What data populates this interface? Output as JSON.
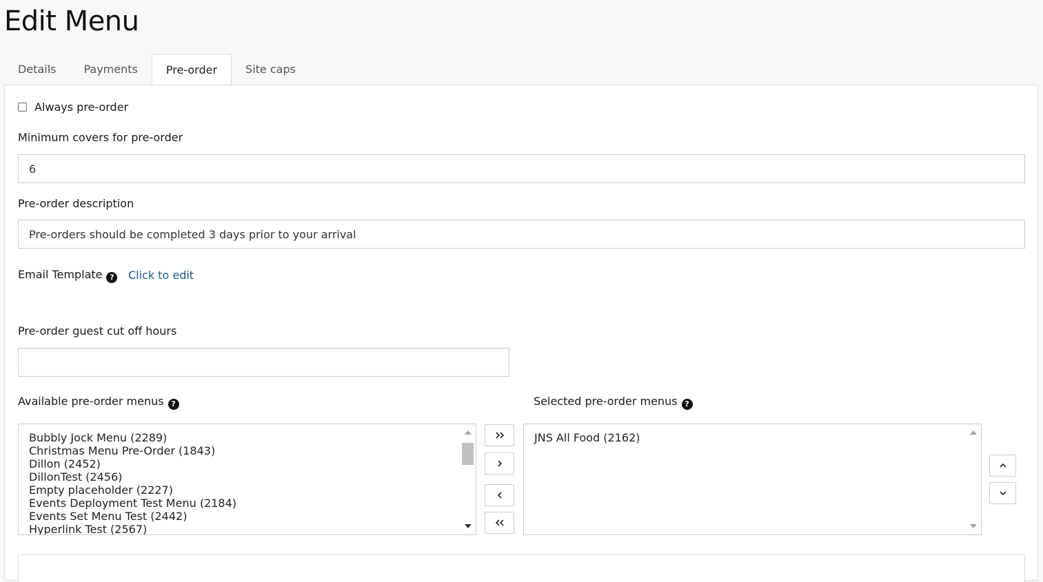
{
  "page": {
    "title": "Edit Menu"
  },
  "tabs": [
    {
      "label": "Details"
    },
    {
      "label": "Payments"
    },
    {
      "label": "Pre-order",
      "active": true
    },
    {
      "label": "Site caps"
    }
  ],
  "form": {
    "always_preorder": {
      "label": "Always pre-order",
      "checked": false
    },
    "min_covers": {
      "label": "Minimum covers for pre-order",
      "value": "6"
    },
    "description": {
      "label": "Pre-order description",
      "value": "Pre-orders should be completed 3 days prior to your arrival"
    },
    "email_template": {
      "label": "Email Template",
      "link": "Click to edit"
    },
    "cut_off_hours": {
      "label": "Pre-order guest cut off hours",
      "value": ""
    }
  },
  "menus": {
    "available_label": "Available pre-order menus",
    "selected_label": "Selected pre-order menus",
    "available": [
      "Bubbly Jock Menu (2289)",
      "Christmas Menu Pre-Order (1843)",
      "Dillon (2452)",
      "DillonTest (2456)",
      "Empty placeholder (2227)",
      "Events Deployment Test Menu (2184)",
      "Events Set Menu Test (2442)",
      "Hyperlink Test (2567)"
    ],
    "selected": [
      "JNS All Food (2162)"
    ],
    "buttons": {
      "move_all_right": "»",
      "move_right": "›",
      "move_left": "‹",
      "move_all_left": "«"
    }
  },
  "icons": {
    "help": "?"
  }
}
